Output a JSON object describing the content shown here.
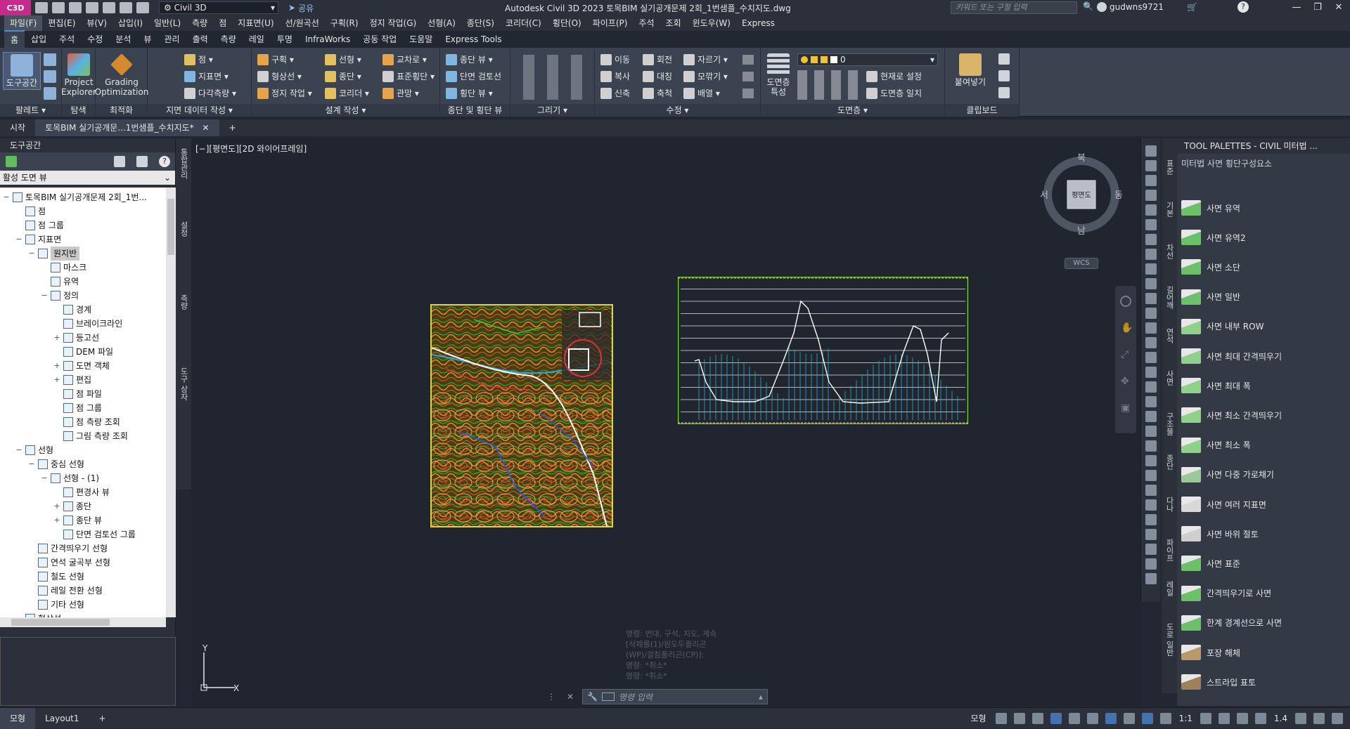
{
  "title_bar": {
    "app_logo": "C3D",
    "workspace": "Civil 3D",
    "share": "공유",
    "window_title": "Autodesk Civil 3D 2023    토목BIM 실기공개문제 2회_1번샘플_수치지도.dwg",
    "search_placeholder": "키워드 또는 구절 입력",
    "username": "gudwns9721"
  },
  "menu": [
    "파일(F)",
    "편집(E)",
    "뷰(V)",
    "삽입(I)",
    "일반(L)",
    "측량",
    "점",
    "지표면(U)",
    "선/원곡선",
    "구획(R)",
    "정지 작업(G)",
    "선형(A)",
    "종단(S)",
    "코리더(C)",
    "횡단(O)",
    "파이프(P)",
    "주석",
    "조회",
    "윈도우(W)",
    "Express"
  ],
  "ribbon_tabs": [
    "홈",
    "삽입",
    "주석",
    "수정",
    "분석",
    "뷰",
    "관리",
    "출력",
    "측량",
    "레일",
    "투명",
    "InfraWorks",
    "공동 작업",
    "도움말",
    "Express Tools"
  ],
  "ribbon": {
    "palette_panel": {
      "title": "팔레트 ▾",
      "toolspace": "도구공간"
    },
    "explore_panel": {
      "title": "탐색",
      "project_explorer": "Project\nExplorer"
    },
    "optimize_panel": {
      "title": "최적화",
      "grading": "Grading\nOptimization"
    },
    "ground_panel": {
      "title": "지면 데이터 작성 ▾",
      "items": [
        "점 ▾",
        "지표면 ▾",
        "다각측량 ▾"
      ]
    },
    "design_panel": {
      "title": "설계 작성 ▾",
      "items": [
        "구획 ▾",
        "형상선 ▾",
        "정지 작업 ▾",
        "선형 ▾",
        "종단 ▾",
        "코리더 ▾",
        "교차로 ▾",
        "표준횡단 ▾",
        "관망 ▾"
      ]
    },
    "profile_panel": {
      "title": "종단 및 횡단 뷰",
      "items": [
        "종단 뷰 ▾",
        "단면 검토선",
        "횡단 뷰 ▾"
      ]
    },
    "draw_panel": {
      "title": "그리기 ▾"
    },
    "modify_panel": {
      "title": "수정 ▾",
      "items": [
        "이동",
        "회전",
        "자르기 ▾",
        "복사",
        "대칭",
        "모깎기 ▾",
        "신축",
        "축척",
        "배열 ▾"
      ]
    },
    "layers_panel": {
      "title": "도면층 ▾",
      "props": "도면층\n특성",
      "current_layer": "0",
      "items": [
        "현재로 설정",
        "도면층 일치"
      ]
    },
    "clipboard_panel": {
      "title": "클립보드",
      "paste": "붙여넣기"
    }
  },
  "doc_tabs": [
    "시작",
    "토목BIM 실기공개문...1번샘플_수치지도*",
    "+"
  ],
  "toolspace": {
    "title": "도구공간",
    "view": "활성 도면 뷰",
    "side_tabs": [
      "통합관리",
      "설정",
      "측량",
      "도구 상자"
    ],
    "tree": [
      {
        "label": "토목BIM 실기공개문제 2회_1번...",
        "level": 0,
        "toggle": "−"
      },
      {
        "label": "점",
        "level": 1,
        "toggle": ""
      },
      {
        "label": "점 그룹",
        "level": 1,
        "toggle": ""
      },
      {
        "label": "지표면",
        "level": 1,
        "toggle": "−"
      },
      {
        "label": "원지반",
        "level": 2,
        "toggle": "−",
        "selected": true
      },
      {
        "label": "마스크",
        "level": 3,
        "toggle": ""
      },
      {
        "label": "유역",
        "level": 3,
        "toggle": ""
      },
      {
        "label": "정의",
        "level": 3,
        "toggle": "−"
      },
      {
        "label": "경계",
        "level": 4,
        "toggle": ""
      },
      {
        "label": "브레이크라인",
        "level": 4,
        "toggle": ""
      },
      {
        "label": "등고선",
        "level": 4,
        "toggle": "+"
      },
      {
        "label": "DEM 파일",
        "level": 4,
        "toggle": ""
      },
      {
        "label": "도면 객체",
        "level": 4,
        "toggle": "+"
      },
      {
        "label": "편집",
        "level": 4,
        "toggle": "+"
      },
      {
        "label": "점 파일",
        "level": 4,
        "toggle": ""
      },
      {
        "label": "점 그룹",
        "level": 4,
        "toggle": ""
      },
      {
        "label": "점 측량 조회",
        "level": 4,
        "toggle": ""
      },
      {
        "label": "그림 측량 조회",
        "level": 4,
        "toggle": ""
      },
      {
        "label": "선형",
        "level": 1,
        "toggle": "−"
      },
      {
        "label": "중심 선형",
        "level": 2,
        "toggle": "−"
      },
      {
        "label": "선형 - (1)",
        "level": 3,
        "toggle": "−"
      },
      {
        "label": "편경사 뷰",
        "level": 4,
        "toggle": ""
      },
      {
        "label": "종단",
        "level": 4,
        "toggle": "+"
      },
      {
        "label": "종단 뷰",
        "level": 4,
        "toggle": "+"
      },
      {
        "label": "단면 검토선 그룹",
        "level": 4,
        "toggle": ""
      },
      {
        "label": "간격띄우기 선형",
        "level": 2,
        "toggle": ""
      },
      {
        "label": "연석 굴곡부 선형",
        "level": 2,
        "toggle": ""
      },
      {
        "label": "철도 선형",
        "level": 2,
        "toggle": ""
      },
      {
        "label": "레일 전환 선형",
        "level": 2,
        "toggle": ""
      },
      {
        "label": "기타 선형",
        "level": 2,
        "toggle": ""
      },
      {
        "label": "형상선",
        "level": 1,
        "toggle": ""
      }
    ]
  },
  "drawing": {
    "viewport_label": "[−][평면도][2D 와이어프레임]",
    "viewcube": {
      "north": "북",
      "south": "남",
      "east": "동",
      "west": "서",
      "face": "평면도",
      "wcs": "WCS"
    },
    "ucs": {
      "x": "X",
      "y": "Y"
    },
    "command_history": [
      "명령: 번대, 구석, 지도, 계속",
      "[삭제를(1)/원도두퀼리곤",
      "(WP)/걸침폴리곤(CP)]:",
      "명령: *취소*",
      "명령: *취소*"
    ],
    "command_placeholder": "명령 입력"
  },
  "tool_palette": {
    "title": "TOOL PALETTES - CIVIL 미터법 ...",
    "subtitle": "미터법 사면 횡단구성요소",
    "side_tabs": [
      "표준",
      "기본",
      "차선",
      "길어깨",
      "연석",
      "사면",
      "구조물",
      "종단",
      "다나",
      "파이프",
      "레일",
      "도로 일반"
    ],
    "items": [
      {
        "label": "사면 유역",
        "color": "#6cc06a"
      },
      {
        "label": "사면 유역2",
        "color": "#6cc06a"
      },
      {
        "label": "사면 소단",
        "color": "#6cc06a"
      },
      {
        "label": "사면 일반",
        "color": "#6cc06a"
      },
      {
        "label": "사면 내부 ROW",
        "color": "#8fd08a"
      },
      {
        "label": "사면 최대 간격띄우기",
        "color": "#8fd08a"
      },
      {
        "label": "사면 최대 폭",
        "color": "#8fd08a"
      },
      {
        "label": "사면 최소 간격띄우기",
        "color": "#8fd08a"
      },
      {
        "label": "사면 최소 폭",
        "color": "#8fd08a"
      },
      {
        "label": "사면 다중 가로채기",
        "color": "#9cc89a"
      },
      {
        "label": "사면 여러 지표면",
        "color": "#d8d8d8"
      },
      {
        "label": "사면 바위 절토",
        "color": "#cfcfcf"
      },
      {
        "label": "사면 표준",
        "color": "#6cc06a"
      },
      {
        "label": "간격띄우기로 사면",
        "color": "#6cc06a"
      },
      {
        "label": "한계 경계선으로 사면",
        "color": "#6cc06a"
      },
      {
        "label": "포장 해체",
        "color": "#b89a6a"
      },
      {
        "label": "스트라입 표토",
        "color": "#a08058"
      }
    ]
  },
  "status_bar": {
    "layout_tabs": [
      "모형",
      "Layout1",
      "+"
    ],
    "model_label": "모형",
    "scale": "1:1",
    "zoom": "1.4"
  },
  "colors": {
    "accent": "#4c8bd6",
    "bg": "#212530",
    "map_border": "#e1d53a",
    "profile_green": "#7fd33a"
  }
}
